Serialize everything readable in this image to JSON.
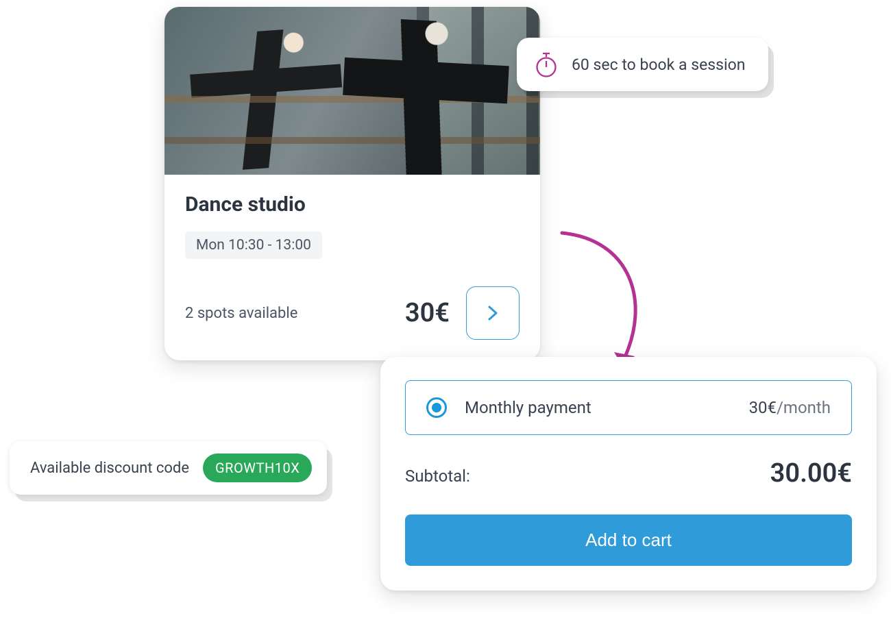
{
  "callout": {
    "text": "60 sec to book a session"
  },
  "product": {
    "title": "Dance studio",
    "schedule": "Mon 10:30 - 13:00",
    "availability": "2 spots available",
    "price": "30€"
  },
  "checkout": {
    "option_label": "Monthly payment",
    "option_price": "30€",
    "option_period": "/month",
    "subtotal_label": "Subtotal:",
    "subtotal_value": "30.00€",
    "cta": "Add to cart"
  },
  "discount": {
    "label": "Available discount code",
    "code": "GROWTH10X"
  }
}
